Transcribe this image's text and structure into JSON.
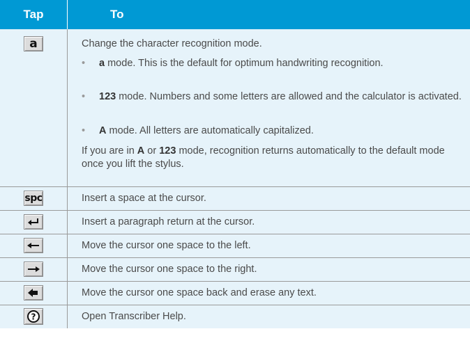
{
  "header": {
    "tap": "Tap",
    "to": "To"
  },
  "mode_row": {
    "icon": "a-mode-icon",
    "intro": "Change the character recognition mode.",
    "bullets": [
      {
        "bold": "a",
        "rest": " mode. This is the default for optimum handwriting recognition."
      },
      {
        "bold": "123",
        "rest": " mode. Numbers and some letters are allowed and the calculator is activated."
      },
      {
        "bold": "A",
        "rest": " mode. All letters are automatically capitalized."
      }
    ],
    "note_parts": [
      "If you are in ",
      "A",
      " or ",
      "123",
      " mode, recognition returns automatically to the default mode once you lift the stylus."
    ]
  },
  "rows": [
    {
      "icon": "space-icon",
      "text": "Insert a space at the cursor."
    },
    {
      "icon": "enter-icon",
      "text": "Insert a paragraph return at the cursor."
    },
    {
      "icon": "left-arrow-icon",
      "text": "Move the cursor one space to the left."
    },
    {
      "icon": "right-arrow-icon",
      "text": "Move the cursor one space to the right."
    },
    {
      "icon": "backspace-icon",
      "text": "Move the cursor one space back and erase any text."
    },
    {
      "icon": "help-icon",
      "text": "Open Transcriber Help."
    }
  ]
}
